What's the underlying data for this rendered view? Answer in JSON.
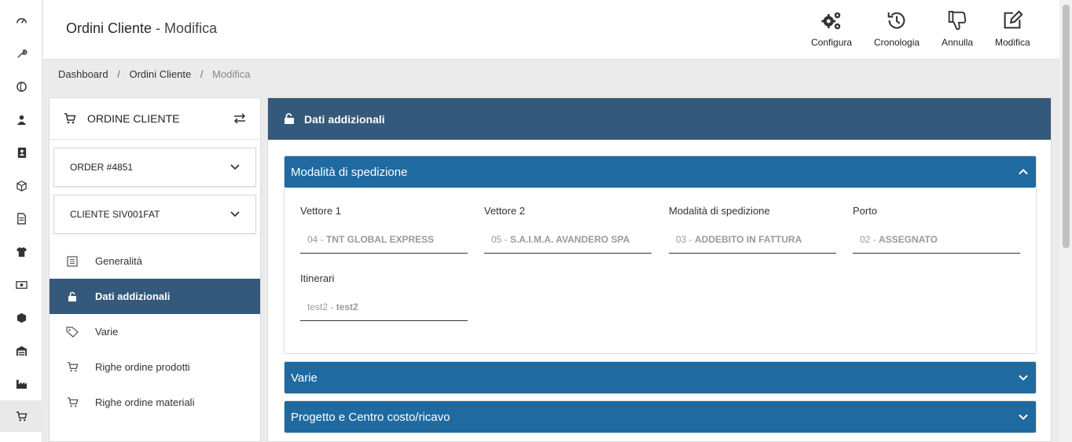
{
  "header": {
    "title": "Ordini Cliente",
    "title_sub": "- Modifica",
    "buttons": [
      {
        "label": "Configura",
        "icon": "cogs-icon"
      },
      {
        "label": "Cronologia",
        "icon": "history-icon"
      },
      {
        "label": "Annulla",
        "icon": "thumbs-down-icon"
      },
      {
        "label": "Modifica",
        "icon": "edit-icon"
      }
    ]
  },
  "breadcrumb": {
    "items": [
      "Dashboard",
      "Ordini Cliente"
    ],
    "current": "Modifica",
    "separator": "/"
  },
  "rail": {
    "icons": [
      "dashboard-icon",
      "wrench-icon",
      "globe-icon",
      "users-icon",
      "address-book-icon",
      "box-icon",
      "document-icon",
      "shirt-icon",
      "money-icon",
      "boxes-icon",
      "warehouse-icon",
      "industry-icon",
      "cart-icon"
    ],
    "active": "cart-icon"
  },
  "sidepanel": {
    "title": "ORDINE CLIENTE",
    "order_select": "ORDER #4851",
    "client_select": "CLIENTE SIV001FAT",
    "nav": [
      {
        "label": "Generalità",
        "icon": "list-icon"
      },
      {
        "label": "Dati addizionali",
        "icon": "unlock-icon",
        "active": true
      },
      {
        "label": "Varie",
        "icon": "tag-icon"
      },
      {
        "label": "Righe ordine prodotti",
        "icon": "cart-icon"
      },
      {
        "label": "Righe ordine materiali",
        "icon": "cart-icon"
      }
    ]
  },
  "main": {
    "title": "Dati addizionali",
    "sections": [
      {
        "title": "Modalità di spedizione",
        "expanded": true,
        "fields": [
          {
            "label": "Vettore 1",
            "code": "04 - ",
            "value": "TNT GLOBAL EXPRESS"
          },
          {
            "label": "Vettore 2",
            "code": "05 - ",
            "value": "S.A.I.M.A. AVANDERO SPA"
          },
          {
            "label": "Modalità di spedizione",
            "code": "03 - ",
            "value": "ADDEBITO IN FATTURA"
          },
          {
            "label": "Porto",
            "code": "02 - ",
            "value": "ASSEGNATO"
          },
          {
            "label": "Itinerari",
            "code": "test2 - ",
            "value": "test2"
          }
        ]
      },
      {
        "title": "Varie",
        "expanded": false
      },
      {
        "title": "Progetto e Centro costo/ricavo",
        "expanded": false
      }
    ]
  },
  "colors": {
    "header_dark": "#35597a",
    "section_blue": "#1f6aa0"
  }
}
